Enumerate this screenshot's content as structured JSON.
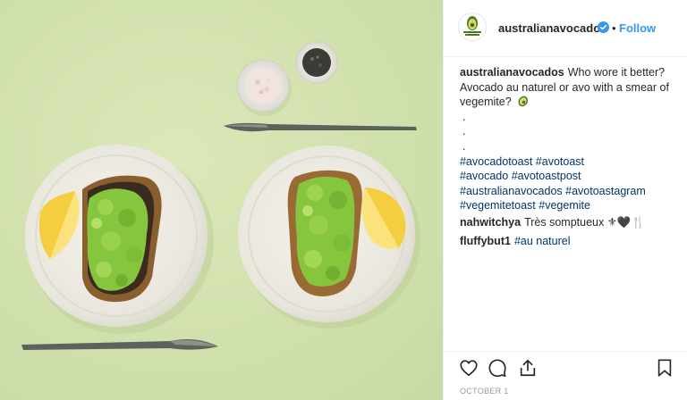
{
  "post": {
    "username": "australianavocados",
    "follow_label": "Follow",
    "separator": "•",
    "date": "OCTOBER 1",
    "logo_text": "australian avocados",
    "caption": {
      "user": "australianavocados",
      "line1": "Who wore it better?",
      "line2": "Avocado au naturel or avo with a smear of",
      "line3": "vegemite?",
      "emoji_icon": "avocado-icon",
      "dot1": ".",
      "dot2": ".",
      "dot3": ".",
      "tags": [
        [
          "#avocadotoast",
          "#avotoast"
        ],
        [
          "#avocado",
          "#avotoastpost"
        ],
        [
          "#australianavocados",
          "#avotoastagram"
        ],
        [
          "#vegemitetoast",
          "#vegemite"
        ]
      ]
    },
    "comments": [
      {
        "user": "nahwitchya",
        "text": "Très somptueux ⚜🖤🍴"
      },
      {
        "user": "fluffybut1",
        "text": "#au naturel"
      }
    ],
    "icons": [
      "heart-icon",
      "comment-icon",
      "share-icon",
      "bookmark-icon",
      "verified-badge-icon"
    ],
    "colors": {
      "follow": "#3897f0",
      "hashtag": "#003569",
      "background": "#d3e2b0",
      "verified": "#3897f0"
    }
  }
}
